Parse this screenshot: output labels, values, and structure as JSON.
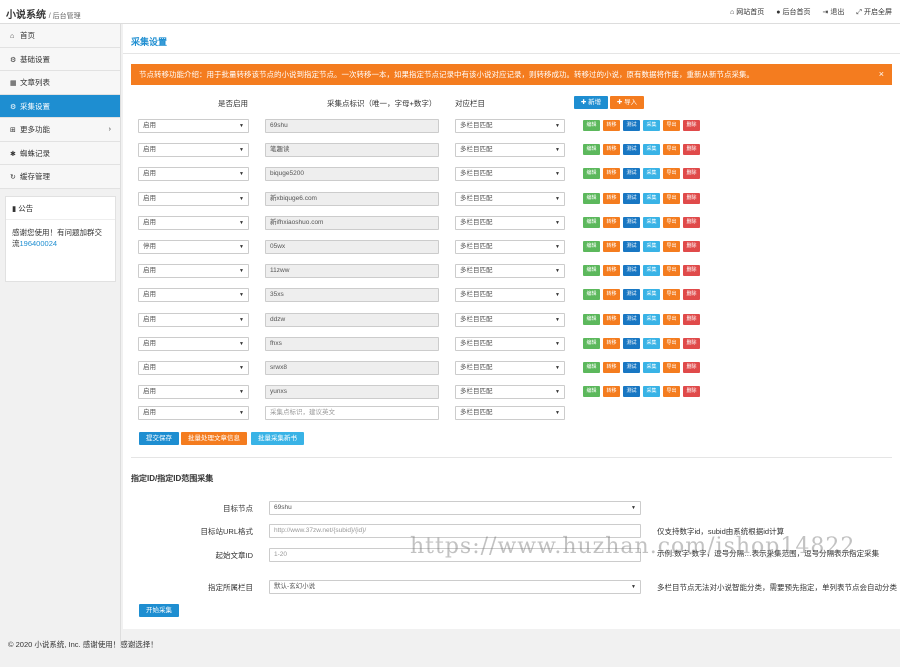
{
  "header": {
    "brand": "小说系统",
    "brand_sub": "/ 后台管理",
    "nav": [
      {
        "icon": "home-icon",
        "glyph": "⌂",
        "label": "网站首页"
      },
      {
        "icon": "user-icon",
        "glyph": "●",
        "label": "后台首页"
      },
      {
        "icon": "logout-icon",
        "glyph": "⇥",
        "label": "退出"
      },
      {
        "icon": "fullscreen-icon",
        "glyph": "⤢",
        "label": "开启全屏"
      }
    ]
  },
  "sidebar": {
    "items": [
      {
        "icon": "home-icon",
        "glyph": "⌂",
        "label": "首页"
      },
      {
        "icon": "gear-icon",
        "glyph": "⚙",
        "label": "基础设置"
      },
      {
        "icon": "list-icon",
        "glyph": "▦",
        "label": "文章列表"
      },
      {
        "icon": "gears-icon",
        "glyph": "⚙",
        "label": "采集设置"
      },
      {
        "icon": "sitemap-icon",
        "glyph": "⊞",
        "label": "更多功能"
      },
      {
        "icon": "spider-icon",
        "glyph": "✱",
        "label": "蜘蛛记录"
      },
      {
        "icon": "refresh-icon",
        "glyph": "↻",
        "label": "缓存管理"
      }
    ],
    "notice": {
      "title": "公告",
      "text": "感谢您使用！有问题加群交流",
      "link": "196400024"
    }
  },
  "main": {
    "title": "采集设置",
    "alert": "节点转移功能介绍：用于批量转移该节点的小说到指定节点。一次转移一本，如果指定节点记录中有该小说对应记录，则转移成功。转移过的小说，原有数据将作废，重新从新节点采集。",
    "alert_close": "×",
    "col_enabled": "是否启用",
    "col_id": "采集点标识（唯一，字母+数字）",
    "col_category": "对应栏目",
    "btn_add": "✚ 新增",
    "btn_import": "✚ 导入",
    "action_labels": [
      "编辑",
      "转移",
      "测试",
      "采集",
      "导出",
      "删除"
    ],
    "rows": [
      {
        "enabled": "启用",
        "id": "69shu",
        "category": "多栏目匹配"
      },
      {
        "enabled": "启用",
        "id": "笔趣读",
        "category": "多栏目匹配"
      },
      {
        "enabled": "启用",
        "id": "biquge5200",
        "category": "多栏目匹配"
      },
      {
        "enabled": "启用",
        "id": "新xbiquge6.com",
        "category": "多栏目匹配"
      },
      {
        "enabled": "启用",
        "id": "新ifhxiaoshuo.com",
        "category": "多栏目匹配"
      },
      {
        "enabled": "停用",
        "id": "05wx",
        "category": "多栏目匹配"
      },
      {
        "enabled": "启用",
        "id": "11zww",
        "category": "多栏目匹配"
      },
      {
        "enabled": "启用",
        "id": "35xs",
        "category": "多栏目匹配"
      },
      {
        "enabled": "启用",
        "id": "ddzw",
        "category": "多栏目匹配"
      },
      {
        "enabled": "启用",
        "id": "fhxs",
        "category": "多栏目匹配"
      },
      {
        "enabled": "启用",
        "id": "srwx8",
        "category": "多栏目匹配"
      },
      {
        "enabled": "启用",
        "id": "yunxs",
        "category": "多栏目匹配"
      }
    ],
    "new_row": {
      "enabled": "启用",
      "placeholder": "采集点标识，建议英文",
      "category": "多栏目匹配"
    },
    "btn_submit": "提交保存",
    "btn_batch_process": "批量处理文章信息",
    "btn_batch_collect": "批量采集新书",
    "range": {
      "title": "指定ID/指定ID范围采集",
      "node_label": "目标节点",
      "node_value": "69shu",
      "url_label": "目标站URL格式",
      "url_placeholder": "http://www.37zw.net/{subid}/{id}/",
      "url_help": "仅支持数字id，subid由系统根据id计算",
      "start_label": "起始文章ID",
      "start_placeholder": "1-20",
      "start_help": "示例:数字-数字，逗号分隔…表示采集范围，逗号分隔表示指定采集",
      "cat_label": "指定所属栏目",
      "cat_value": "默认-玄幻小说",
      "cat_help": "多栏目节点无法对小说智能分类，需要预先指定，单列表节点会自动分类",
      "btn_start": "开始采集"
    }
  },
  "footer": "© 2020 小说系统, Inc. 感谢使用！感谢选择！",
  "watermark": "https://www.huzhan.com/ishop14822",
  "colors": {
    "primary": "#1e8ed1",
    "orange": "#f47c1f",
    "green": "#5cb85c",
    "sky": "#39b3e6",
    "red": "#e04a4a"
  }
}
